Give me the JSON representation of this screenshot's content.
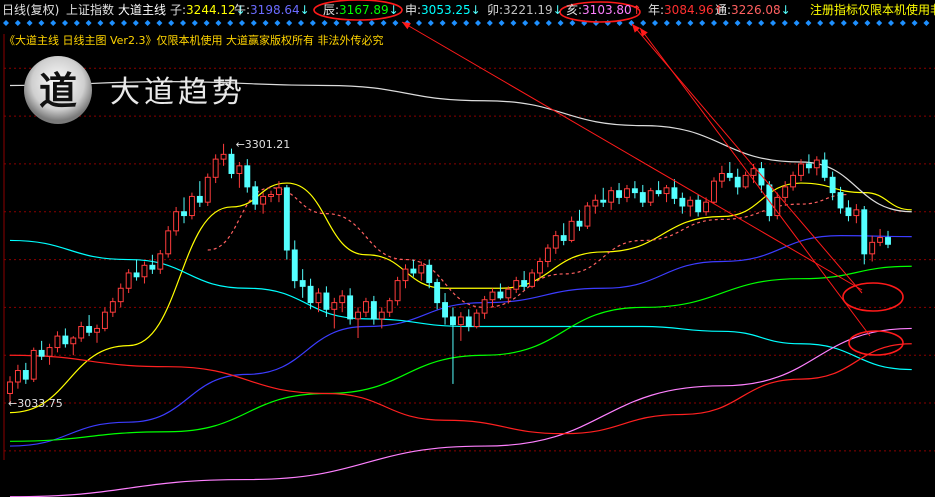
{
  "header": {
    "period": "日线(复权)",
    "index_name": "上证指数",
    "indicator_name": "大道主线",
    "items": [
      {
        "label": "子:",
        "value": "3244.12",
        "arrow": "down",
        "color": "#ffff00"
      },
      {
        "label": "午:",
        "value": "3198.64",
        "arrow": "down",
        "color": "#6b6bff"
      },
      {
        "label": "辰:",
        "value": "3167.89",
        "arrow": "down",
        "color": "#00ff00"
      },
      {
        "label": "申:",
        "value": "3053.25",
        "arrow": "down",
        "color": "#00ffff"
      },
      {
        "label": "卯:",
        "value": "3221.19",
        "arrow": "down",
        "color": "#c0c0c0"
      },
      {
        "label": "亥:",
        "value": "3103.80",
        "arrow": "up",
        "color": "#ff80ff"
      },
      {
        "label": "年:",
        "value": "3084.96",
        "arrow": "up",
        "color": "#ff3030"
      },
      {
        "label": "通:",
        "value": "3226.08",
        "arrow": "down",
        "color": "#ff6060"
      }
    ],
    "trailing": "注册指标仅限本机使用非"
  },
  "notice": "《大道主线 日线主图 Ver2.3》仅限本机使用 大道赢家版权所有 非法外传必究",
  "logo": {
    "emblem": "道",
    "title": "大道趋势"
  },
  "colors": {
    "up": "#ff3c3c",
    "down": "#54ffff",
    "grid": "#8b0000"
  },
  "chart_data": {
    "type": "candlestick",
    "ylim": [
      2960,
      3420
    ],
    "annotations": [
      {
        "text": "3301.21",
        "kind": "high"
      },
      {
        "text": "3033.75",
        "kind": "low"
      }
    ],
    "candles": [
      [
        3040,
        3058,
        3030,
        3052
      ],
      [
        3052,
        3070,
        3045,
        3064
      ],
      [
        3064,
        3072,
        3050,
        3055
      ],
      [
        3055,
        3088,
        3052,
        3085
      ],
      [
        3085,
        3095,
        3075,
        3079
      ],
      [
        3079,
        3092,
        3070,
        3088
      ],
      [
        3088,
        3105,
        3083,
        3100
      ],
      [
        3100,
        3108,
        3088,
        3092
      ],
      [
        3092,
        3100,
        3080,
        3098
      ],
      [
        3098,
        3115,
        3094,
        3110
      ],
      [
        3110,
        3122,
        3100,
        3104
      ],
      [
        3104,
        3112,
        3093,
        3108
      ],
      [
        3108,
        3130,
        3105,
        3125
      ],
      [
        3125,
        3140,
        3120,
        3136
      ],
      [
        3136,
        3155,
        3130,
        3150
      ],
      [
        3150,
        3170,
        3145,
        3166
      ],
      [
        3166,
        3180,
        3158,
        3162
      ],
      [
        3162,
        3178,
        3155,
        3174
      ],
      [
        3174,
        3185,
        3165,
        3170
      ],
      [
        3170,
        3190,
        3165,
        3186
      ],
      [
        3186,
        3215,
        3182,
        3210
      ],
      [
        3210,
        3235,
        3205,
        3230
      ],
      [
        3230,
        3245,
        3218,
        3226
      ],
      [
        3226,
        3250,
        3222,
        3246
      ],
      [
        3246,
        3262,
        3235,
        3240
      ],
      [
        3240,
        3270,
        3236,
        3266
      ],
      [
        3266,
        3290,
        3260,
        3285
      ],
      [
        3285,
        3301,
        3278,
        3290
      ],
      [
        3290,
        3296,
        3265,
        3270
      ],
      [
        3270,
        3282,
        3255,
        3278
      ],
      [
        3278,
        3285,
        3250,
        3256
      ],
      [
        3256,
        3262,
        3232,
        3238
      ],
      [
        3238,
        3250,
        3228,
        3246
      ],
      [
        3246,
        3252,
        3240,
        3248
      ],
      [
        3248,
        3262,
        3240,
        3255
      ],
      [
        3255,
        3258,
        3180,
        3190
      ],
      [
        3190,
        3200,
        3150,
        3158
      ],
      [
        3158,
        3170,
        3140,
        3152
      ],
      [
        3152,
        3160,
        3128,
        3135
      ],
      [
        3135,
        3150,
        3125,
        3145
      ],
      [
        3145,
        3152,
        3120,
        3128
      ],
      [
        3128,
        3140,
        3108,
        3135
      ],
      [
        3135,
        3148,
        3125,
        3142
      ],
      [
        3142,
        3150,
        3112,
        3118
      ],
      [
        3118,
        3130,
        3098,
        3125
      ],
      [
        3125,
        3140,
        3120,
        3136
      ],
      [
        3136,
        3142,
        3112,
        3118
      ],
      [
        3118,
        3130,
        3108,
        3125
      ],
      [
        3125,
        3140,
        3120,
        3137
      ],
      [
        3137,
        3162,
        3132,
        3158
      ],
      [
        3158,
        3175,
        3150,
        3170
      ],
      [
        3170,
        3180,
        3162,
        3166
      ],
      [
        3166,
        3178,
        3158,
        3174
      ],
      [
        3174,
        3180,
        3150,
        3156
      ],
      [
        3156,
        3160,
        3128,
        3135
      ],
      [
        3135,
        3145,
        3112,
        3120
      ],
      [
        3120,
        3130,
        3050,
        3112
      ],
      [
        3112,
        3125,
        3095,
        3120
      ],
      [
        3120,
        3128,
        3105,
        3110
      ],
      [
        3110,
        3128,
        3108,
        3124
      ],
      [
        3124,
        3142,
        3118,
        3138
      ],
      [
        3138,
        3150,
        3130,
        3146
      ],
      [
        3146,
        3155,
        3138,
        3140
      ],
      [
        3140,
        3152,
        3134,
        3149
      ],
      [
        3149,
        3162,
        3145,
        3158
      ],
      [
        3158,
        3168,
        3148,
        3152
      ],
      [
        3152,
        3170,
        3150,
        3166
      ],
      [
        3166,
        3182,
        3160,
        3178
      ],
      [
        3178,
        3196,
        3172,
        3192
      ],
      [
        3192,
        3210,
        3186,
        3205
      ],
      [
        3205,
        3218,
        3195,
        3200
      ],
      [
        3200,
        3225,
        3198,
        3220
      ],
      [
        3220,
        3232,
        3210,
        3215
      ],
      [
        3215,
        3240,
        3212,
        3236
      ],
      [
        3236,
        3248,
        3228,
        3242
      ],
      [
        3242,
        3255,
        3235,
        3240
      ],
      [
        3240,
        3256,
        3232,
        3252
      ],
      [
        3252,
        3260,
        3238,
        3245
      ],
      [
        3245,
        3258,
        3240,
        3254
      ],
      [
        3254,
        3262,
        3244,
        3250
      ],
      [
        3250,
        3258,
        3235,
        3240
      ],
      [
        3240,
        3255,
        3236,
        3252
      ],
      [
        3252,
        3262,
        3246,
        3249
      ],
      [
        3249,
        3258,
        3240,
        3255
      ],
      [
        3255,
        3264,
        3238,
        3244
      ],
      [
        3244,
        3250,
        3228,
        3236
      ],
      [
        3236,
        3246,
        3225,
        3242
      ],
      [
        3242,
        3248,
        3225,
        3230
      ],
      [
        3230,
        3245,
        3226,
        3240
      ],
      [
        3240,
        3266,
        3238,
        3262
      ],
      [
        3262,
        3278,
        3255,
        3270
      ],
      [
        3270,
        3282,
        3262,
        3266
      ],
      [
        3266,
        3275,
        3248,
        3256
      ],
      [
        3256,
        3272,
        3254,
        3268
      ],
      [
        3268,
        3280,
        3260,
        3275
      ],
      [
        3275,
        3282,
        3250,
        3258
      ],
      [
        3258,
        3262,
        3220,
        3226
      ],
      [
        3226,
        3250,
        3222,
        3245
      ],
      [
        3245,
        3262,
        3240,
        3256
      ],
      [
        3256,
        3272,
        3252,
        3268
      ],
      [
        3268,
        3285,
        3262,
        3280
      ],
      [
        3280,
        3290,
        3270,
        3276
      ],
      [
        3276,
        3288,
        3268,
        3284
      ],
      [
        3284,
        3292,
        3262,
        3266
      ],
      [
        3266,
        3272,
        3242,
        3250
      ],
      [
        3250,
        3256,
        3228,
        3234
      ],
      [
        3234,
        3242,
        3220,
        3226
      ],
      [
        3226,
        3238,
        3218,
        3232
      ],
      [
        3232,
        3236,
        3175,
        3186
      ],
      [
        3186,
        3205,
        3178,
        3198
      ],
      [
        3198,
        3212,
        3194,
        3203
      ],
      [
        3203,
        3210,
        3192,
        3196
      ]
    ],
    "lines": [
      {
        "name": "子",
        "color": "#ffff00",
        "points": [
          [
            0,
            3020
          ],
          [
            15,
            3090
          ],
          [
            28,
            3235
          ],
          [
            35,
            3260
          ],
          [
            45,
            3185
          ],
          [
            55,
            3150
          ],
          [
            62,
            3150
          ],
          [
            75,
            3188
          ],
          [
            90,
            3225
          ],
          [
            100,
            3260
          ],
          [
            108,
            3250
          ],
          [
            114,
            3232
          ]
        ]
      },
      {
        "name": "卯",
        "color": "#dcdcdc",
        "points": [
          [
            0,
            3362
          ],
          [
            20,
            3366
          ],
          [
            40,
            3362
          ],
          [
            60,
            3346
          ],
          [
            80,
            3320
          ],
          [
            100,
            3282
          ],
          [
            114,
            3230
          ]
        ]
      },
      {
        "name": "午",
        "color": "#3c3cff",
        "points": [
          [
            0,
            2985
          ],
          [
            15,
            3010
          ],
          [
            30,
            3060
          ],
          [
            45,
            3110
          ],
          [
            60,
            3135
          ],
          [
            75,
            3150
          ],
          [
            90,
            3178
          ],
          [
            105,
            3205
          ],
          [
            114,
            3204
          ]
        ]
      },
      {
        "name": "申",
        "color": "#00ffff",
        "points": [
          [
            0,
            3200
          ],
          [
            15,
            3180
          ],
          [
            30,
            3150
          ],
          [
            45,
            3118
          ],
          [
            58,
            3110
          ],
          [
            70,
            3110
          ],
          [
            80,
            3110
          ],
          [
            90,
            3105
          ],
          [
            100,
            3092
          ],
          [
            114,
            3065
          ]
        ]
      },
      {
        "name": "辰",
        "color": "#00ff00",
        "points": [
          [
            0,
            2990
          ],
          [
            20,
            3000
          ],
          [
            40,
            3040
          ],
          [
            60,
            3080
          ],
          [
            80,
            3130
          ],
          [
            100,
            3160
          ],
          [
            114,
            3173
          ]
        ]
      },
      {
        "name": "亥",
        "color": "#ff80ff",
        "points": [
          [
            0,
            2932
          ],
          [
            30,
            2950
          ],
          [
            60,
            2985
          ],
          [
            90,
            3048
          ],
          [
            114,
            3108
          ]
        ]
      },
      {
        "name": "年",
        "color": "#ff2020",
        "points": [
          [
            0,
            3080
          ],
          [
            20,
            3068
          ],
          [
            40,
            3040
          ],
          [
            55,
            3012
          ],
          [
            70,
            2998
          ],
          [
            85,
            3018
          ],
          [
            100,
            3055
          ],
          [
            114,
            3092
          ]
        ]
      },
      {
        "name": "通",
        "color": "#ff6060",
        "points": [
          [
            25,
            3190
          ],
          [
            33,
            3255
          ],
          [
            40,
            3228
          ],
          [
            50,
            3180
          ],
          [
            60,
            3130
          ],
          [
            70,
            3165
          ],
          [
            80,
            3200
          ],
          [
            90,
            3222
          ],
          [
            100,
            3238
          ],
          [
            106,
            3248
          ]
        ]
      }
    ]
  }
}
